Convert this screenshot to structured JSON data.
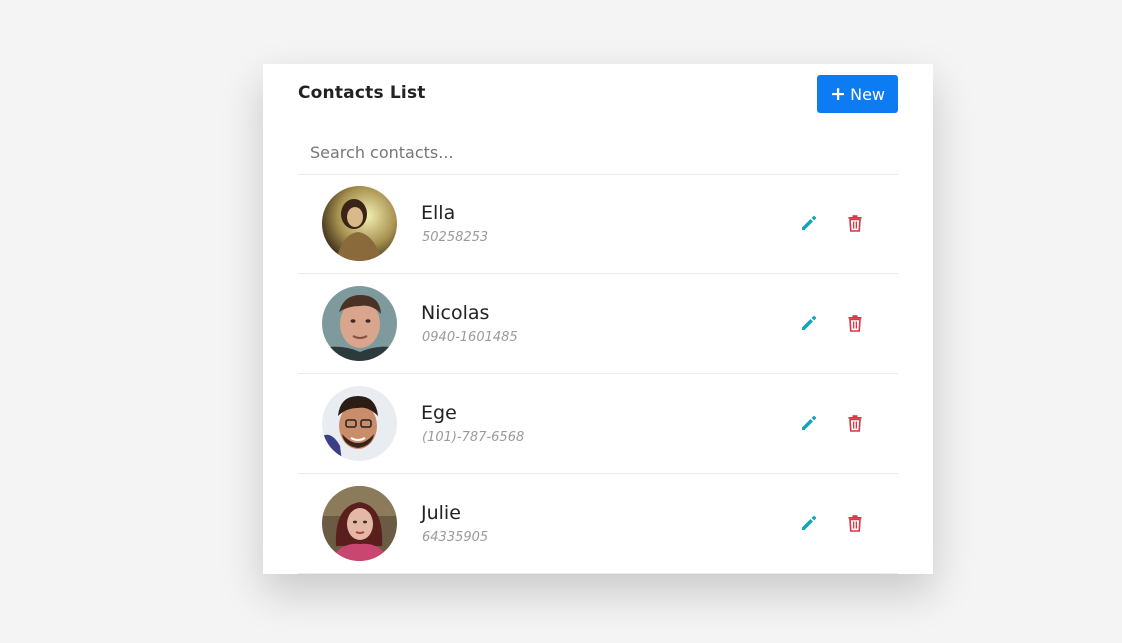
{
  "header": {
    "title": "Contacts List",
    "new_button_label": "New"
  },
  "search": {
    "placeholder": "Search contacts...",
    "value": ""
  },
  "contacts": [
    {
      "name": "Ella",
      "phone": "50258253"
    },
    {
      "name": "Nicolas",
      "phone": "0940-1601485"
    },
    {
      "name": "Ege",
      "phone": "(101)-787-6568"
    },
    {
      "name": "Julie",
      "phone": "64335905"
    }
  ],
  "icons": {
    "new": "plus-icon",
    "edit": "pencil-icon",
    "delete": "trash-icon"
  },
  "colors": {
    "primary": "#0d7cf2",
    "edit": "#17a2b8",
    "delete": "#dc3545",
    "background": "#f4f4f4"
  }
}
